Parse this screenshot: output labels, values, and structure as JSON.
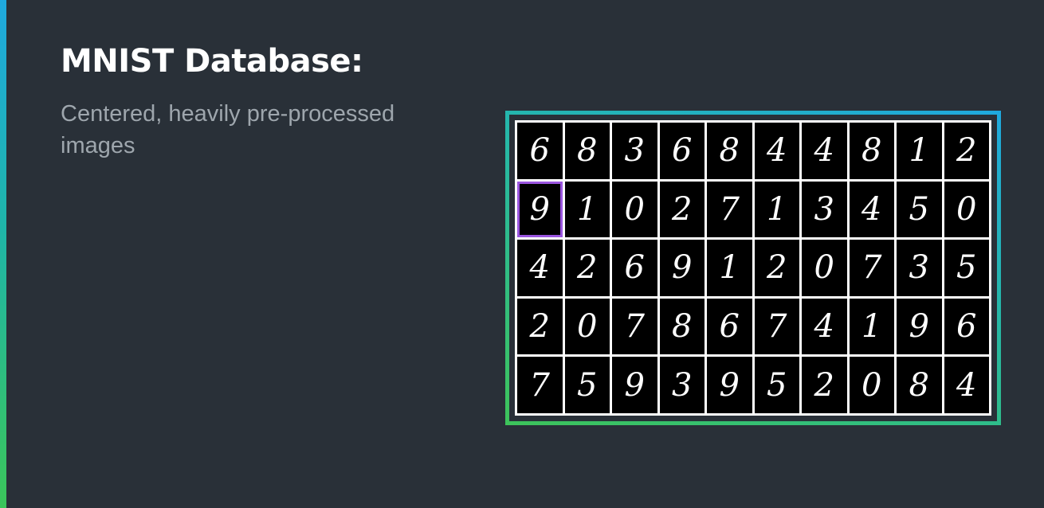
{
  "slide": {
    "title": "MNIST Database:",
    "subtitle": "Centered, heavily pre-processed images"
  },
  "digit_grid": {
    "rows": [
      [
        "6",
        "8",
        "3",
        "6",
        "8",
        "4",
        "4",
        "8",
        "1",
        "2"
      ],
      [
        "9",
        "1",
        "0",
        "2",
        "7",
        "1",
        "3",
        "4",
        "5",
        "0"
      ],
      [
        "4",
        "2",
        "6",
        "9",
        "1",
        "2",
        "0",
        "7",
        "3",
        "5"
      ],
      [
        "2",
        "0",
        "7",
        "8",
        "6",
        "7",
        "4",
        "1",
        "9",
        "6"
      ],
      [
        "7",
        "5",
        "9",
        "3",
        "9",
        "5",
        "2",
        "0",
        "8",
        "4"
      ]
    ],
    "highlighted_cell": {
      "row": 1,
      "col": 0
    },
    "highlight_color": "#9a55e0",
    "frame_colors": [
      "#1fa9df",
      "#3dc35a"
    ]
  }
}
